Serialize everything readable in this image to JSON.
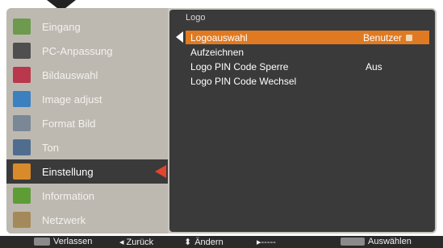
{
  "sidebar": {
    "items": [
      {
        "label": "Eingang",
        "icon": "input-icon",
        "color": "#6d9a4c"
      },
      {
        "label": "PC-Anpassung",
        "icon": "pc-icon",
        "color": "#4f4f4f"
      },
      {
        "label": "Bildauswahl",
        "icon": "image-select-icon",
        "color": "#b9384b"
      },
      {
        "label": "Image adjust",
        "icon": "image-adjust-icon",
        "color": "#3b80bf"
      },
      {
        "label": "Format Bild",
        "icon": "screen-format-icon",
        "color": "#7a8796"
      },
      {
        "label": "Ton",
        "icon": "speaker-icon",
        "color": "#4f6d8f"
      },
      {
        "label": "Einstellung",
        "icon": "settings-icon",
        "color": "#d98a2a"
      },
      {
        "label": "Information",
        "icon": "info-icon",
        "color": "#5e9d36"
      },
      {
        "label": "Netzwerk",
        "icon": "network-icon",
        "color": "#a48a5a"
      }
    ],
    "active_index": 6
  },
  "panel": {
    "title": "Logo",
    "rows": [
      {
        "label": "Logoauswahl",
        "value": "Benutzer"
      },
      {
        "label": "Aufzeichnen",
        "value": ""
      },
      {
        "label": "Logo PIN Code Sperre",
        "value": "Aus"
      },
      {
        "label": "Logo PIN Code Wechsel",
        "value": ""
      }
    ],
    "selected_index": 0
  },
  "footer": {
    "exit": "Verlassen",
    "back": "Zurück",
    "change": "Ändern",
    "next_symbol": "▸-----",
    "select": "Auswählen"
  },
  "colors": {
    "accent": "#e07a22",
    "active_marker": "#e4452e",
    "panel_bg": "#3a3a3a",
    "osd_bg": "#c9c6bf"
  }
}
